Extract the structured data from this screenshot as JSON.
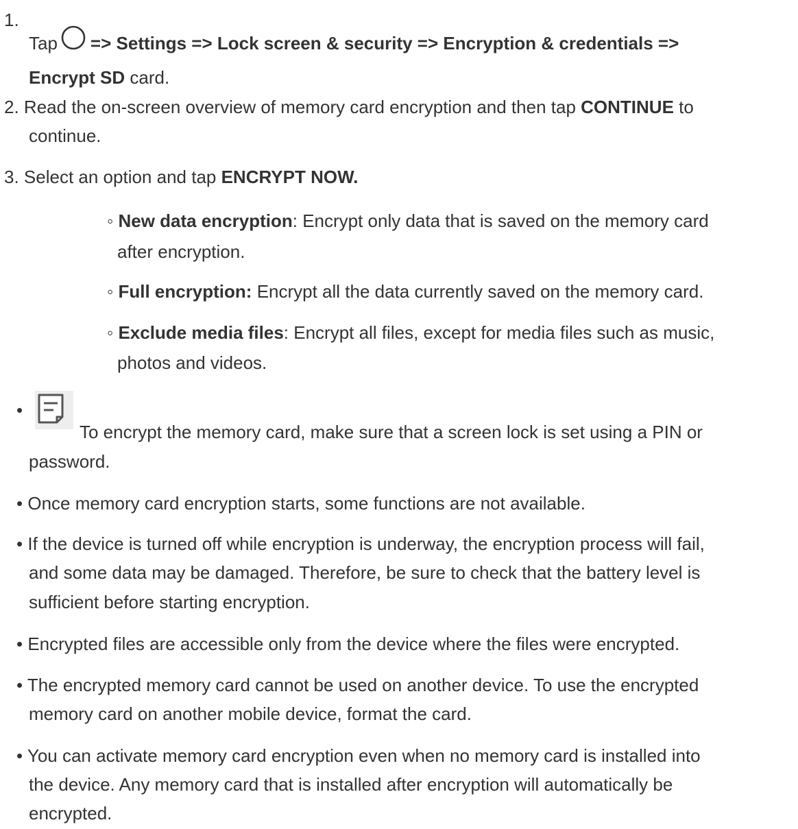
{
  "steps": [
    {
      "number": "1.",
      "tap": "Tap",
      "path": "=> Settings => Lock screen & security => Encryption & credentials =>",
      "path_end_bold": "Encrypt SD",
      "path_end": " card."
    },
    {
      "number": "2.",
      "text_a": "Read the on-screen overview of memory card encryption and then tap ",
      "bold": "CONTINUE",
      "text_b": " to",
      "text_c": "continue."
    },
    {
      "number": "3.",
      "text_a": "Select an option and tap ",
      "bold": "ENCRYPT NOW."
    }
  ],
  "options": [
    {
      "bullet": "◦",
      "title": "New data encryption",
      "sep": ": ",
      "desc_line1": "Encrypt only data that is saved on the memory card",
      "desc_line2": "after encryption."
    },
    {
      "bullet": "◦",
      "title": "Full encryption:",
      "sep": " ",
      "desc_line1": "Encrypt all the data currently saved on the memory card."
    },
    {
      "bullet": "◦",
      "title": "Exclude media files",
      "sep": ": ",
      "desc_line1": "Encrypt all files, except for media files such as music,",
      "desc_line2": "photos and videos."
    }
  ],
  "notes": [
    {
      "bullet": "•",
      "line1": "To encrypt the memory card, make sure that a screen lock is set using a PIN or",
      "line2": "password."
    },
    {
      "bullet": "•",
      "line1": "Once memory card encryption starts, some functions are not available."
    },
    {
      "bullet": "•",
      "line1": "If the device is turned off while encryption is underway, the encryption process will fail,",
      "line2": "and some data may be damaged. Therefore, be sure to check that the battery level is",
      "line3": "sufficient before starting encryption."
    },
    {
      "bullet": "•",
      "line1": "Encrypted files are accessible only from the device where the files were encrypted."
    },
    {
      "bullet": "•",
      "line1": "The encrypted memory card cannot be used on another device. To use the encrypted",
      "line2": "memory card on another mobile device, format the card."
    },
    {
      "bullet": "•",
      "line1": "You can activate memory card encryption even when no memory card is installed into",
      "line2": "the device. Any memory card that is installed after encryption will automatically be",
      "line3": "encrypted."
    }
  ],
  "icons": {
    "home": "home-button-icon",
    "note": "note-icon"
  }
}
